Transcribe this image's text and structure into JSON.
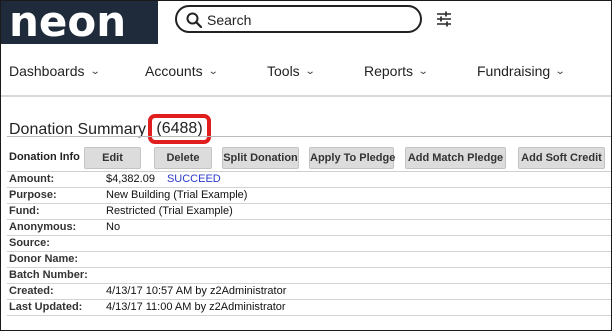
{
  "brand": {
    "logo_text": "neon"
  },
  "search": {
    "placeholder": "Search"
  },
  "nav": {
    "items": [
      {
        "label": "Dashboards"
      },
      {
        "label": "Accounts"
      },
      {
        "label": "Tools"
      },
      {
        "label": "Reports"
      },
      {
        "label": "Fundraising"
      }
    ]
  },
  "section": {
    "title": "Donation Summary",
    "count": "(6488)"
  },
  "toolbar": {
    "label": "Donation Info",
    "buttons": [
      {
        "label": "Edit"
      },
      {
        "label": "Delete"
      },
      {
        "label": "Split Donation"
      },
      {
        "label": "Apply To Pledge"
      },
      {
        "label": "Add Match Pledge"
      },
      {
        "label": "Add Soft Credit"
      }
    ]
  },
  "details": {
    "amount": {
      "label": "Amount:",
      "value": "$4,382.09",
      "status": "SUCCEED"
    },
    "purpose": {
      "label": "Purpose:",
      "value": "New Building (Trial Example)"
    },
    "fund": {
      "label": "Fund:",
      "value": "Restricted (Trial Example)"
    },
    "anonymous": {
      "label": "Anonymous:",
      "value": "No"
    },
    "source": {
      "label": "Source:",
      "value": ""
    },
    "donor_name": {
      "label": "Donor Name:",
      "value": ""
    },
    "batch_number": {
      "label": "Batch Number:",
      "value": ""
    },
    "created": {
      "label": "Created:",
      "value": "4/13/17 10:57 AM by z2Administrator"
    },
    "last_updated": {
      "label": "Last Updated:",
      "value": "4/13/17 11:00 AM by z2Administrator"
    }
  },
  "colors": {
    "logo_bg": "#1f2b3a",
    "status_link": "#2a3bcc",
    "highlight": "#e01e1e",
    "button_bg": "#dcdcdc"
  },
  "icons": [
    "search-icon",
    "filter-sliders-icon",
    "chevron-down-icon"
  ]
}
